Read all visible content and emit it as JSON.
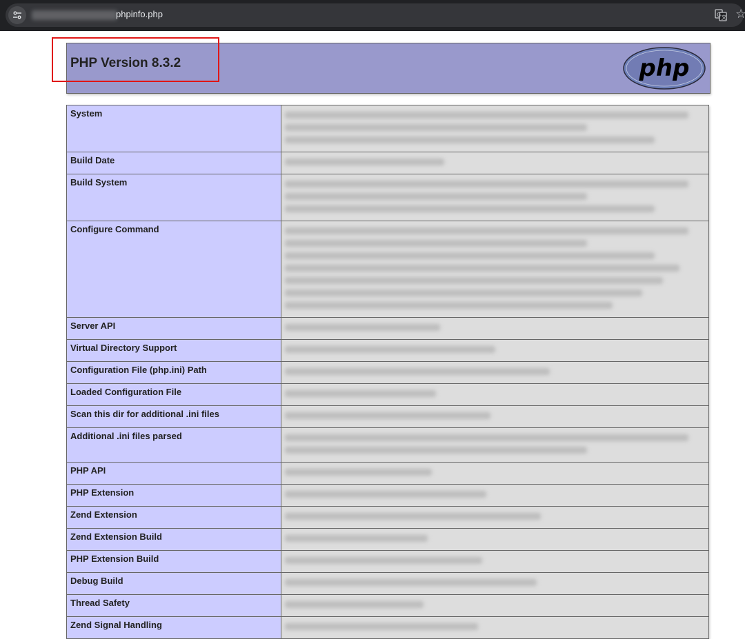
{
  "browser": {
    "url_visible": "phpinfo.php"
  },
  "header": {
    "version": "PHP Version 8.3.2",
    "logo_text": "php"
  },
  "rows": [
    {
      "label": "System",
      "lines": 3
    },
    {
      "label": "Build Date",
      "lines": 1
    },
    {
      "label": "Build System",
      "lines": 3
    },
    {
      "label": "Configure Command",
      "lines": 7
    },
    {
      "label": "Server API",
      "lines": 1
    },
    {
      "label": "Virtual Directory Support",
      "lines": 1
    },
    {
      "label": "Configuration File (php.ini) Path",
      "lines": 1
    },
    {
      "label": "Loaded Configuration File",
      "lines": 1
    },
    {
      "label": "Scan this dir for additional .ini files",
      "lines": 1
    },
    {
      "label": "Additional .ini files parsed",
      "lines": 2
    },
    {
      "label": "PHP API",
      "lines": 1
    },
    {
      "label": "PHP Extension",
      "lines": 1
    },
    {
      "label": "Zend Extension",
      "lines": 1
    },
    {
      "label": "Zend Extension Build",
      "lines": 1
    },
    {
      "label": "PHP Extension Build",
      "lines": 1
    },
    {
      "label": "Debug Build",
      "lines": 1
    },
    {
      "label": "Thread Safety",
      "lines": 1
    },
    {
      "label": "Zend Signal Handling",
      "lines": 1
    }
  ],
  "colors": {
    "header_bg": "#9999cc",
    "label_bg": "#ccccff",
    "value_bg": "#dddddd",
    "highlight": "#e01616"
  },
  "icons": {
    "site_info": "tune-icon",
    "translate": "translate-icon",
    "bookmark": "star-icon"
  }
}
